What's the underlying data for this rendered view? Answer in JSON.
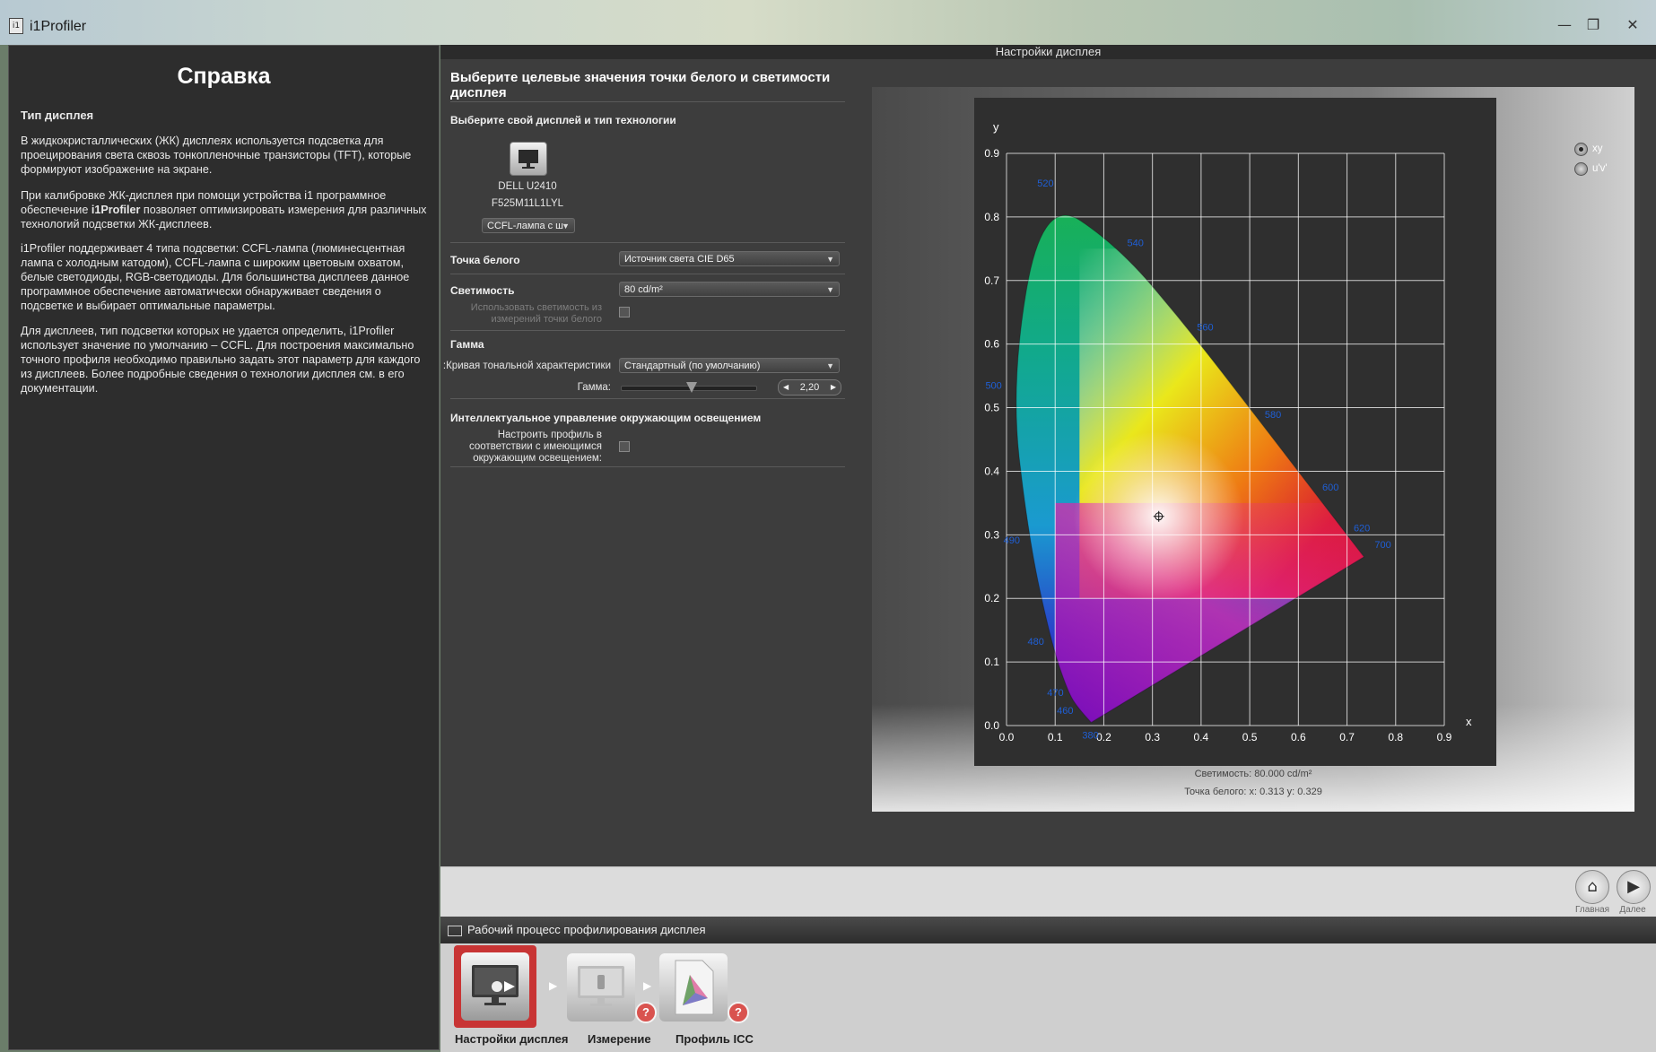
{
  "window": {
    "title": "i1Profiler",
    "minimize": "—",
    "maximize": "❐",
    "close": "✕"
  },
  "help": {
    "title": "Справка",
    "section_title": "Тип дисплея",
    "para1": "В жидкокристаллических (ЖК) дисплеях используется подсветка для проецирования света сквозь тонкопленочные транзисторы (TFT), которые формируют изображение на экране.",
    "para2_a": "При калибровке ЖК-дисплея при помощи устройства i1 программное обеспечение ",
    "para2_b": "i1Profiler",
    "para2_c": " позволяет оптимизировать измерения для различных технологий подсветки ЖК-дисплеев.",
    "para3": "i1Profiler поддерживает 4 типа подсветки: CCFL-лампа (люминесцентная лампа с холодным катодом), CCFL-лампа с широким цветовым охватом, белые светодиоды, RGB-светодиоды. Для большинства дисплеев данное программное обеспечение автоматически обнаруживает сведения о подсветке и выбирает оптимальные параметры.",
    "para4": "Для дисплеев, тип подсветки которых не удается определить, i1Profiler использует значение по умолчанию – CCFL. Для построения максимально точного профиля необходимо правильно задать этот параметр для каждого из дисплеев. Более подробные сведения о технологии дисплея см. в его документации."
  },
  "settings": {
    "header": "Настройки дисплея",
    "heading": "Выберите целевые значения точки белого и светимости дисплея",
    "display_section": "Выберите свой дисплей и тип технологии",
    "display_name": "DELL U2410",
    "display_serial": "F525M11L1LYL",
    "backlight_value": "CCFL-лампа с ш",
    "whitepoint_label": "Точка белого",
    "whitepoint_value": "Источник света CIE D65",
    "luminance_label": "Светимость",
    "luminance_value": "80 cd/m²",
    "use_measured_label": "Использовать светимость из измерений точки белого",
    "gamma_section": "Гамма",
    "tone_curve_label": "Кривая тональной характеристики:",
    "tone_curve_value": "Стандартный (по умолчанию)",
    "gamma_label": "Гамма:",
    "gamma_value": "2,20",
    "gamma_level": 0.52,
    "ambient_section": "Интеллектуальное управление окружающим освещением",
    "ambient_label_1": "Настроить профиль в",
    "ambient_label_2": "соответствии с имеющимся",
    "ambient_label_3": "окружающим освещением:"
  },
  "chart": {
    "radio_xy": "xy",
    "radio_uv": "u'v'",
    "luminance_readout": "Светимость: 80.000 cd/m²",
    "whitepoint_readout": "Точка белого: x: 0.313  y: 0.329"
  },
  "chart_data": {
    "type": "scatter",
    "title": "",
    "xlabel": "x",
    "ylabel": "y",
    "xlim": [
      0,
      0.9
    ],
    "ylim": [
      0,
      0.9
    ],
    "grid": true,
    "x_ticks": [
      "0.0",
      "0.1",
      "0.2",
      "0.3",
      "0.4",
      "0.5",
      "0.6",
      "0.7",
      "0.8",
      "0.9"
    ],
    "y_ticks": [
      "0.0",
      "0.1",
      "0.2",
      "0.3",
      "0.4",
      "0.5",
      "0.6",
      "0.7",
      "0.8",
      "0.9"
    ],
    "spectral_locus": [
      {
        "nm": "380",
        "x": 0.1741,
        "y": 0.005
      },
      {
        "nm": "460",
        "x": 0.144,
        "y": 0.0297
      },
      {
        "nm": "470",
        "x": 0.1241,
        "y": 0.0578
      },
      {
        "nm": "480",
        "x": 0.0913,
        "y": 0.1327
      },
      {
        "nm": "490",
        "x": 0.0454,
        "y": 0.295
      },
      {
        "nm": "500",
        "x": 0.0082,
        "y": 0.5384
      },
      {
        "nm": "520",
        "x": 0.0743,
        "y": 0.8338
      },
      {
        "nm": "540",
        "x": 0.2296,
        "y": 0.7543
      },
      {
        "nm": "560",
        "x": 0.3731,
        "y": 0.6245
      },
      {
        "nm": "580",
        "x": 0.5125,
        "y": 0.4866
      },
      {
        "nm": "600",
        "x": 0.627,
        "y": 0.3725
      },
      {
        "nm": "620",
        "x": 0.6915,
        "y": 0.3083
      },
      {
        "nm": "700",
        "x": 0.7347,
        "y": 0.2653
      }
    ],
    "white_point": {
      "x": 0.313,
      "y": 0.329
    }
  },
  "nav": {
    "home_label": "Главная",
    "next_label": "Далее"
  },
  "workflow": {
    "title": "Рабочий процесс профилирования дисплея",
    "steps": [
      "Настройки дисплея",
      "Измерение",
      "Профиль ICC"
    ],
    "badge": "?"
  }
}
